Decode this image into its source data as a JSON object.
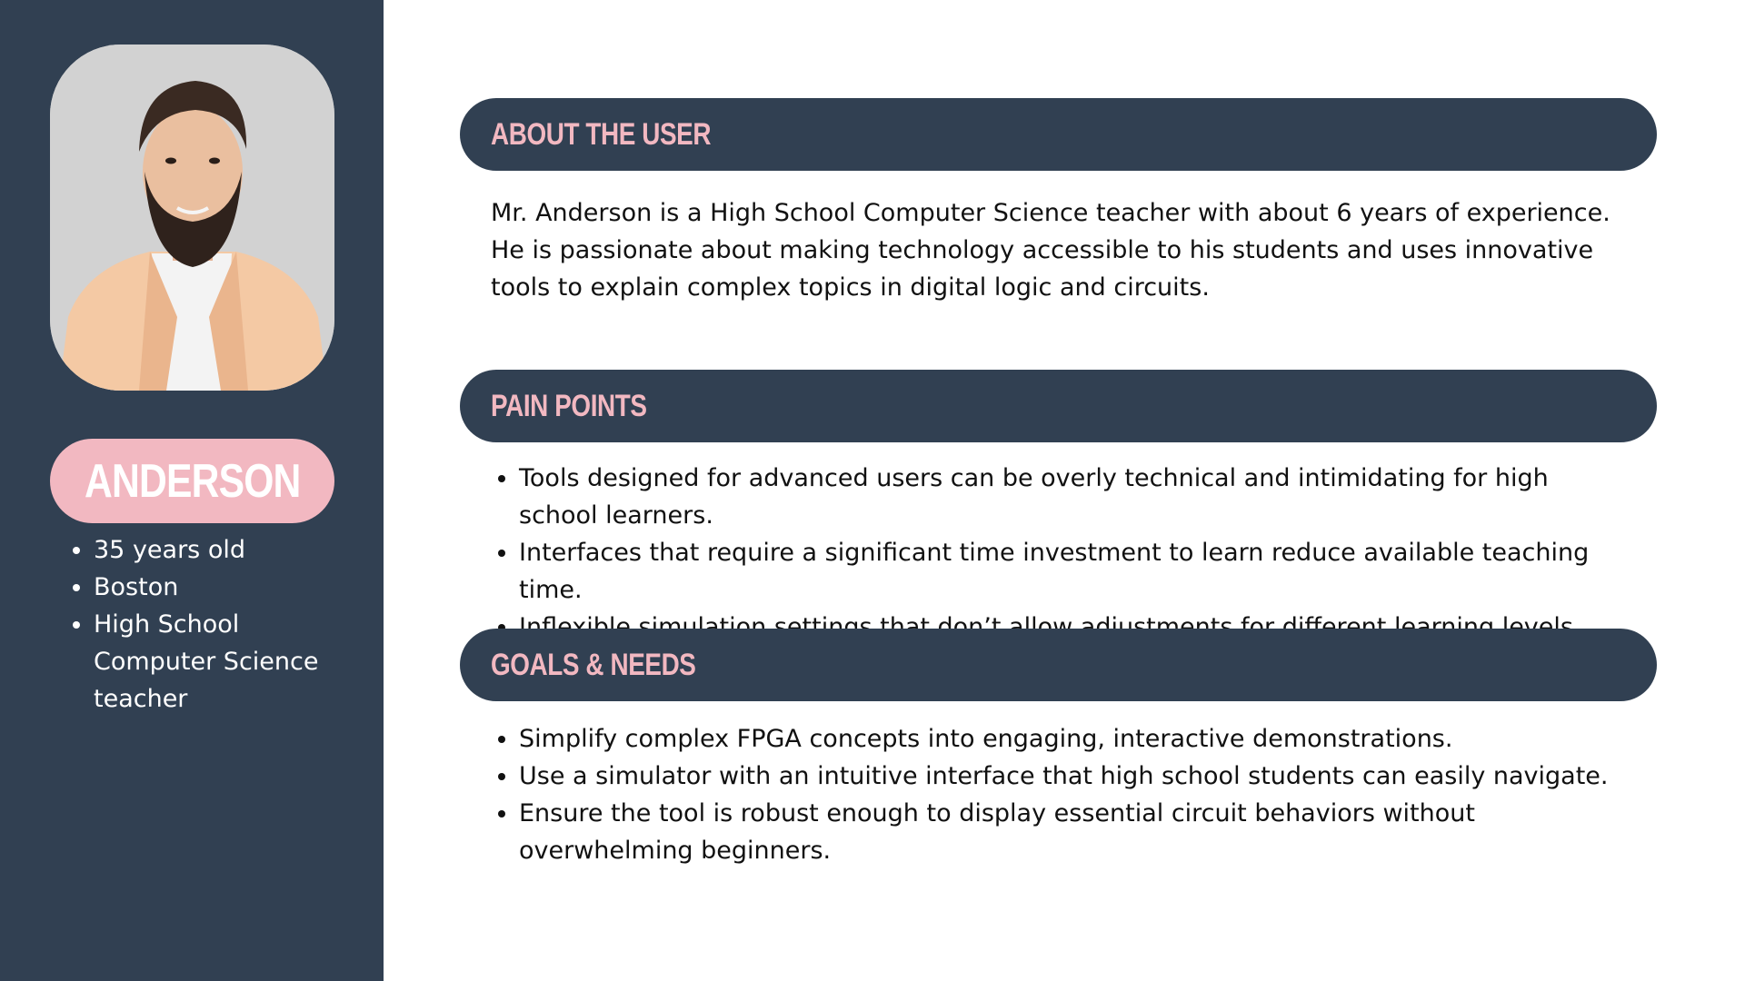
{
  "profile": {
    "name": "ANDERSON",
    "facts": [
      "35 years old",
      "Boston",
      "High School Computer Science teacher"
    ]
  },
  "about": {
    "title": "ABOUT THE USER",
    "text": "Mr. Anderson is a High School Computer Science teacher with about 6 years of experience. He is passionate about making technology accessible to his students and uses innovative tools to explain complex topics in digital logic and circuits."
  },
  "pain_points": {
    "title": "PAIN POINTS",
    "items": [
      "Tools designed for advanced users can be overly technical and intimidating for high school learners.",
      "Interfaces that require a significant time investment to learn reduce available teaching time.",
      "Inflexible simulation settings that don’t allow adjustments for different learning levels."
    ]
  },
  "goals": {
    "title": "GOALS & NEEDS",
    "items": [
      "Simplify complex FPGA concepts into engaging, interactive demonstrations.",
      "Use a simulator with an intuitive interface that high school students can easily navigate.",
      "Ensure the tool is robust enough to display essential circuit behaviors without overwhelming beginners."
    ]
  },
  "colors": {
    "navy": "#314052",
    "pink": "#f2b8c1",
    "white": "#ffffff",
    "text": "#111111"
  }
}
